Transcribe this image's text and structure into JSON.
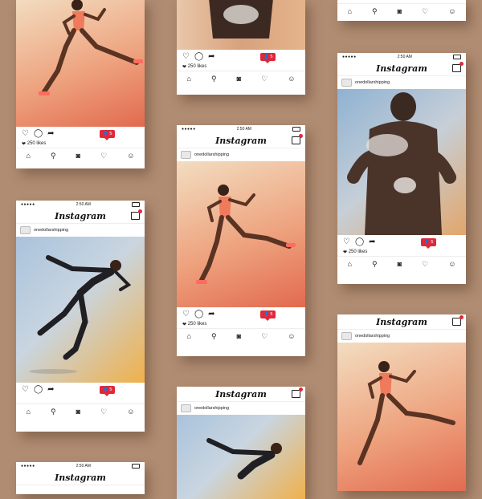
{
  "app": {
    "logo": "Instagram",
    "time": "2:50 AM",
    "signal": "●●●●● ",
    "username": "onedollarshipping",
    "likes": "250 likes",
    "notification_count": "5"
  },
  "icons": {
    "like": "heart-icon",
    "comment": "comment-icon",
    "share": "share-icon",
    "home": "home-icon",
    "search": "search-icon",
    "camera": "camera-icon",
    "activity": "heart-icon",
    "profile": "profile-icon"
  },
  "colors": {
    "background": "#b08c72",
    "notification": "#e0283a"
  }
}
